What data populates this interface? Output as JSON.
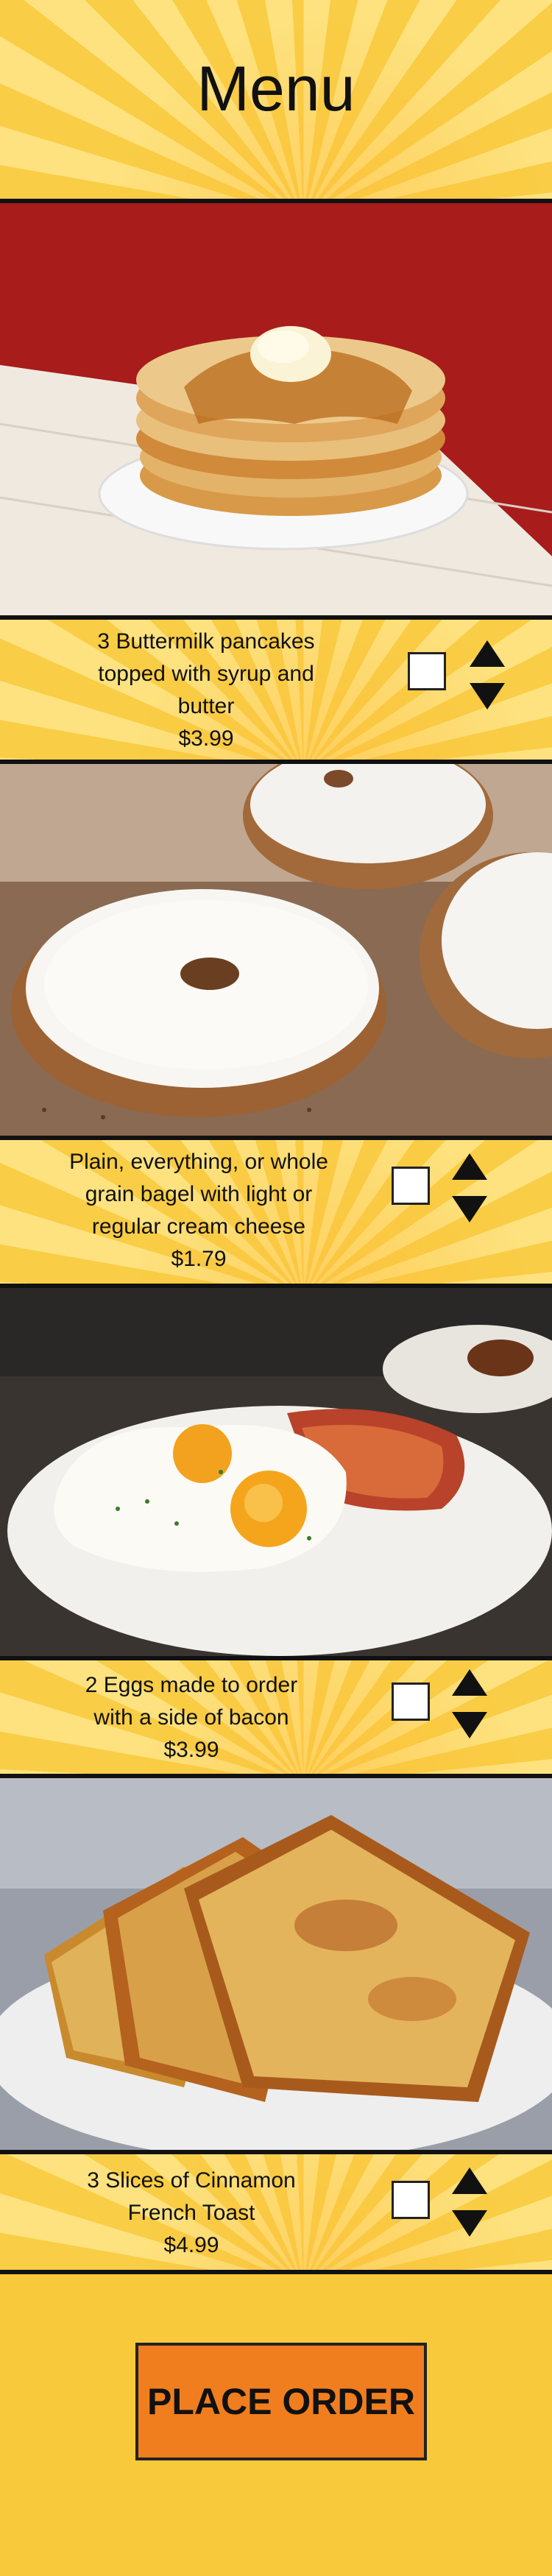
{
  "header": {
    "title": "Menu"
  },
  "menu_items": [
    {
      "line1": "3 Buttermilk pancakes",
      "line2": "topped with syrup and",
      "line3": "butter",
      "price": "$3.99"
    },
    {
      "line1": "Plain, everything, or whole",
      "line2": "grain bagel with light or",
      "line3": "regular cream cheese",
      "price": "$1.79"
    },
    {
      "line1": "2 Eggs made to order",
      "line2": "with a side of bacon",
      "price": "$3.99"
    },
    {
      "line1": "3 Slices of Cinnamon",
      "line2": "French Toast",
      "price": "$4.99"
    }
  ],
  "footer": {
    "place_order_label": "PLACE ORDER"
  },
  "colors": {
    "background": "#f8c83e",
    "button": "#f07e1e",
    "text": "#111111"
  }
}
